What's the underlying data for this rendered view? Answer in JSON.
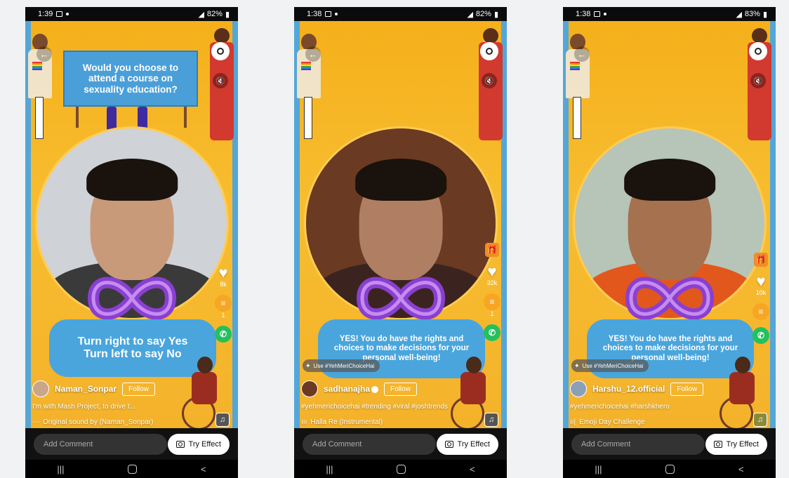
{
  "common": {
    "comment_placeholder": "Add Comment",
    "try_effect_label": "Try Effect",
    "follow_label": "Follow",
    "nav_recent": "|||",
    "nav_back": "<"
  },
  "phones": [
    {
      "status_time": "1:39",
      "battery": "82%",
      "sign_text": "Would you choose to attend a course on sexuality education?",
      "bubble_text_line1": "Turn right to say Yes",
      "bubble_text_line2": "Turn left to say No",
      "effect_tag": "",
      "likes": "8k",
      "comments": "1",
      "username": "Naman_Sonpar",
      "verified": false,
      "caption": "I'm with Mash Project, to drive t...",
      "sound": "Original sound by (Naman_Sonpar)",
      "sound_prefix": "···",
      "colors": {
        "skin": "#c89a7a",
        "shirt": "#3a3a3a",
        "bg": "#cfd2d6"
      }
    },
    {
      "status_time": "1:38",
      "battery": "82%",
      "sign_text": "",
      "bubble_text": "YES! You do have the rights and choices to make decisions for your personal well-being!",
      "effect_tag": "Use #YehMeriChoiceHai",
      "likes": "32k",
      "comments": "1",
      "username": "sadhanajha",
      "verified": true,
      "caption": "#yehmerichoicehai #trending #viral #joshtrends",
      "sound": "Halla Re (Instrumental)",
      "sound_prefix": "ııı",
      "colors": {
        "skin": "#b07e62",
        "shirt": "#3b2420",
        "bg": "#6b3a22"
      }
    },
    {
      "status_time": "1:38",
      "battery": "83%",
      "sign_text": "",
      "bubble_text": "YES! You do have the rights and choices to make decisions for your personal well-being!",
      "effect_tag": "Use #YehMeriChoiceHai",
      "likes": "10k",
      "comments": "",
      "username": "Harshu_12.official",
      "verified": false,
      "caption": "#yehmerichoicehai #harshkhero",
      "sound": "Emoji Day Challenge",
      "sound_prefix": "ıı|",
      "colors": {
        "skin": "#a5714e",
        "shirt": "#e2571c",
        "bg": "#b7c4b8"
      }
    }
  ]
}
